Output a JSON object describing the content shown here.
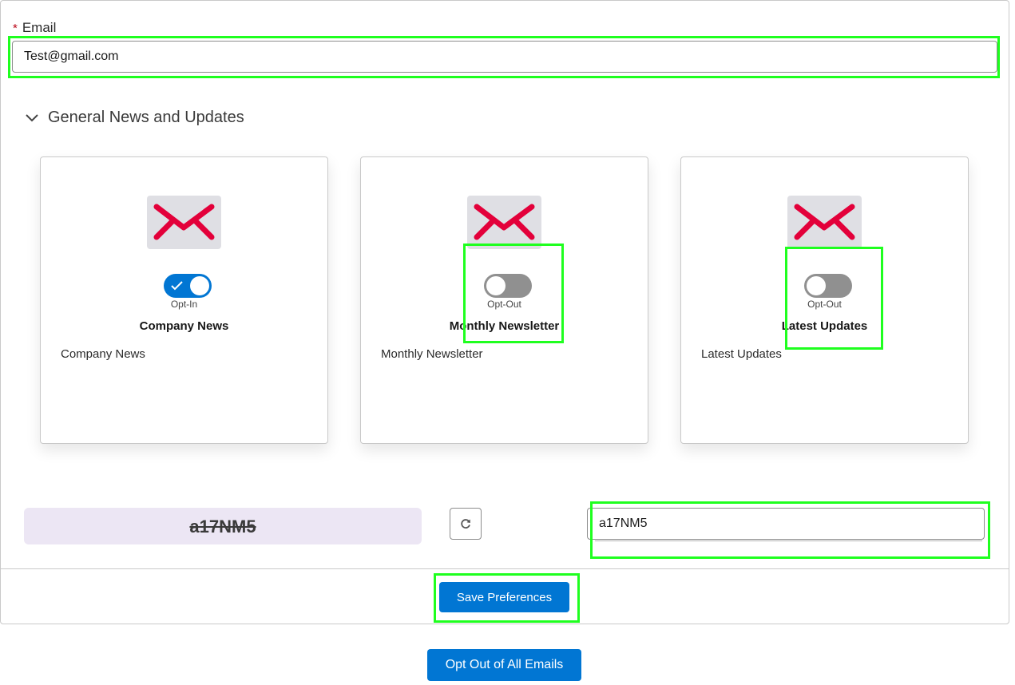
{
  "email": {
    "label": "Email",
    "required_marker": "*",
    "value": "Test@gmail.com"
  },
  "section": {
    "title": "General News and Updates",
    "expanded": true
  },
  "cards": [
    {
      "title": "Company News",
      "description": "Company News",
      "toggle_state": "Opt-In",
      "opted_in": true
    },
    {
      "title": "Monthly Newsletter",
      "description": "Monthly Newsletter",
      "toggle_state": "Opt-Out",
      "opted_in": false
    },
    {
      "title": "Latest Updates",
      "description": "Latest Updates",
      "toggle_state": "Opt-Out",
      "opted_in": false
    }
  ],
  "captcha": {
    "code": "a17NM5",
    "input_value": "a17NM5"
  },
  "buttons": {
    "save": "Save Preferences",
    "opt_out_all": "Opt Out of All Emails"
  },
  "colors": {
    "brand": "#0176d3",
    "mail_icon": "#e3003a",
    "highlight": "#1fff1f",
    "captcha_bg": "#ece6f4"
  }
}
